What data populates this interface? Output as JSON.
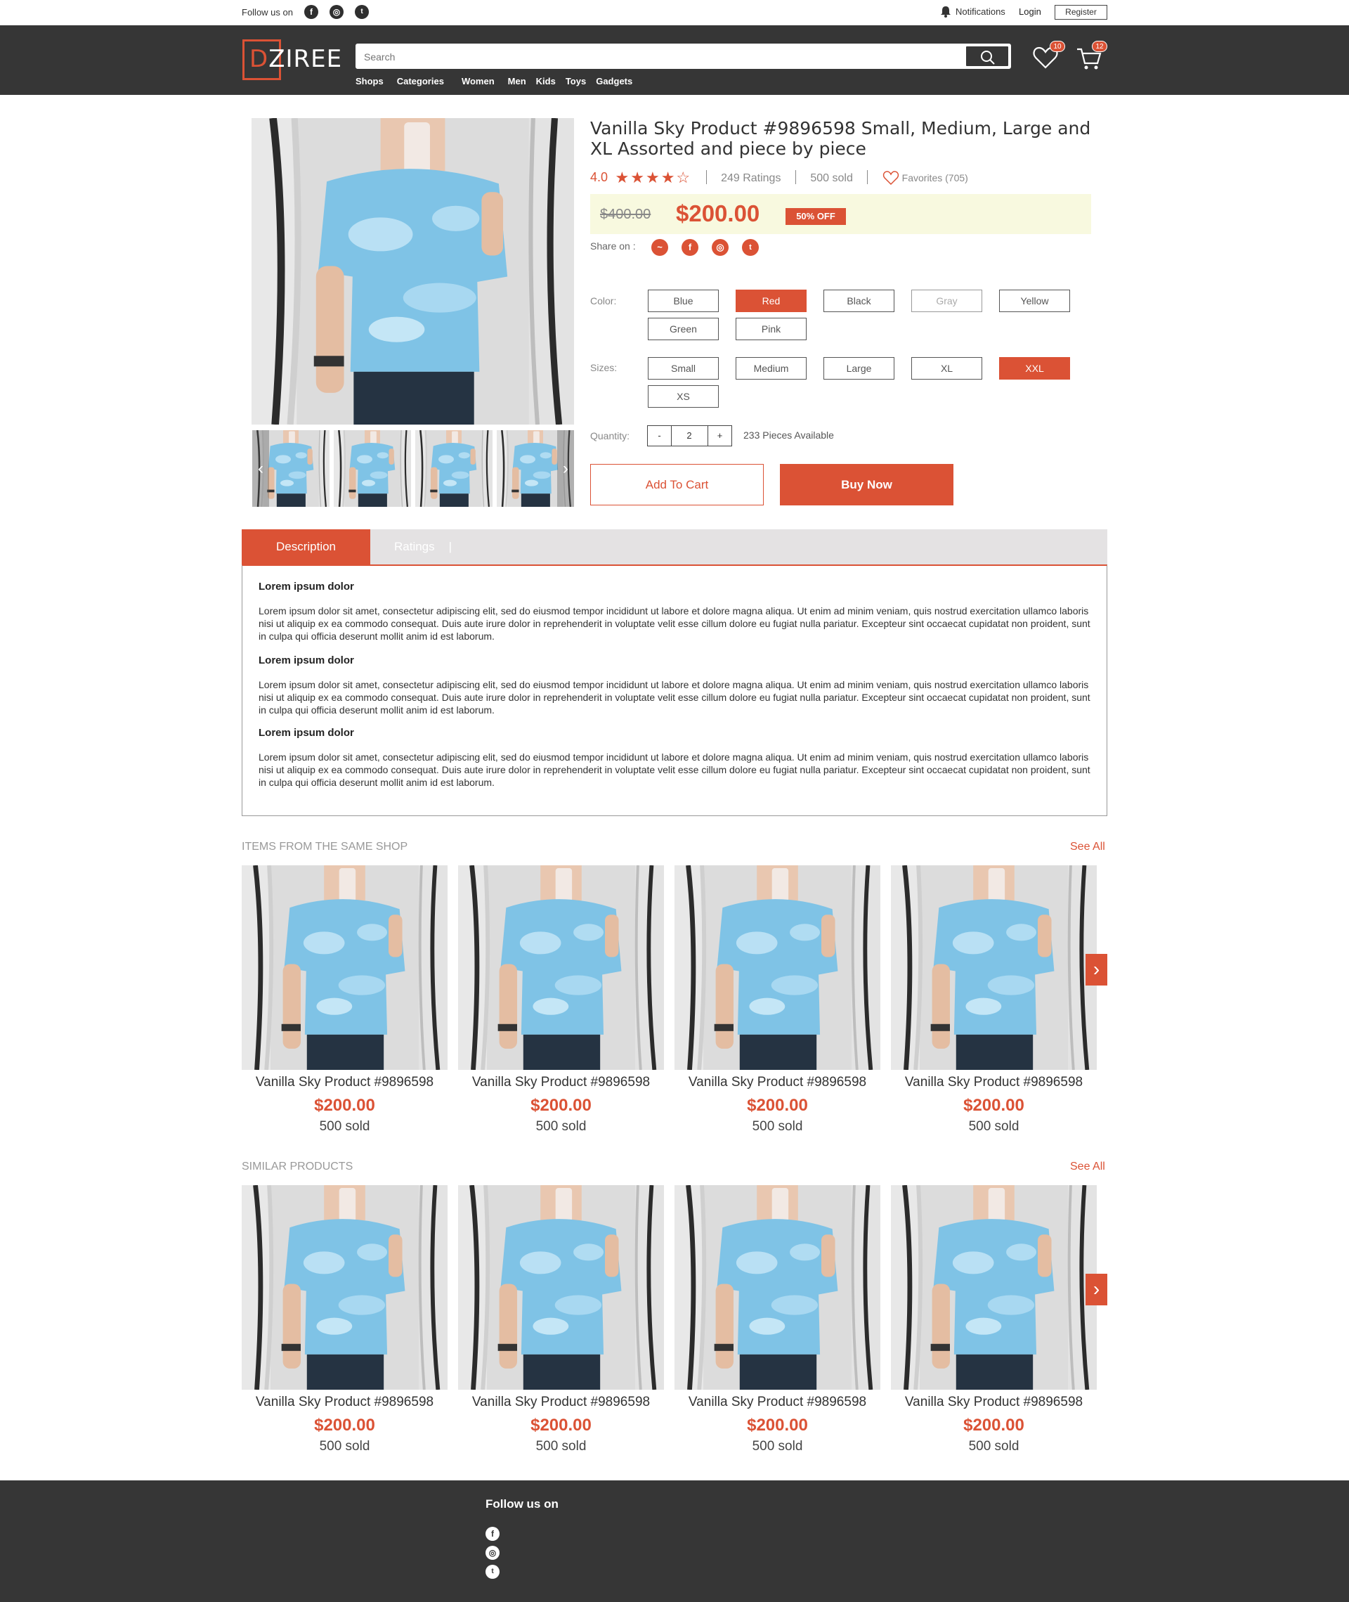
{
  "topbar": {
    "follow_label": "Follow us on",
    "social": [
      "facebook-icon",
      "instagram-icon",
      "twitter-icon"
    ],
    "notifications_label": "Notifications",
    "login_label": "Login",
    "register_label": "Register"
  },
  "header": {
    "logo_text_accent": "D",
    "logo_text": "ZIREE",
    "search_placeholder": "Search",
    "nav": [
      "Shops",
      "Categories",
      "Women",
      "Men",
      "Kids",
      "Toys",
      "Gadgets"
    ],
    "wishlist_count": "10",
    "cart_count": "12"
  },
  "product": {
    "title": "Vanilla Sky Product #9896598 Small, Medium, Large and XL Assorted and piece by piece",
    "rating_value": "4.0",
    "stars": 4,
    "ratings_label": "249 Ratings",
    "sold_label": "500 sold",
    "favorites_label": "Favorites (705)",
    "old_price": "$400.00",
    "price": "$200.00",
    "discount": "50% OFF",
    "share_label": "Share on :",
    "share_icons": [
      "messenger-icon",
      "facebook-icon",
      "instagram-icon",
      "twitter-icon"
    ],
    "color_label": "Color:",
    "colors": [
      "Blue",
      "Red",
      "Black",
      "Gray",
      "Yellow",
      "Green",
      "Pink"
    ],
    "selected_color": "Red",
    "disabled_color": "Gray",
    "sizes_label": "Sizes:",
    "sizes": [
      "Small",
      "Medium",
      "Large",
      "XL",
      "XXL",
      "XS"
    ],
    "selected_size": "XXL",
    "quantity_label": "Quantity:",
    "qty_minus": "-",
    "quantity": "2",
    "qty_plus": "+",
    "available": "233 Pieces Available",
    "add_to_cart": "Add To Cart",
    "buy_now": "Buy Now"
  },
  "tabs": {
    "description": "Description",
    "ratings": "Ratings",
    "ratings_sep": "|"
  },
  "description": [
    {
      "heading": "Lorem ipsum dolor",
      "text": "Lorem ipsum dolor sit amet, consectetur adipiscing elit, sed do eiusmod tempor incididunt ut labore et dolore magna aliqua. Ut enim ad minim veniam, quis nostrud exercitation ullamco laboris nisi ut aliquip ex ea commodo consequat. Duis aute irure dolor in reprehenderit in voluptate velit esse cillum dolore eu fugiat nulla pariatur. Excepteur sint occaecat cupidatat non proident, sunt in culpa qui officia deserunt mollit anim id est laborum."
    },
    {
      "heading": "Lorem ipsum dolor",
      "text": "Lorem ipsum dolor sit amet, consectetur adipiscing elit, sed do eiusmod tempor incididunt ut labore et dolore magna aliqua. Ut enim ad minim veniam, quis nostrud exercitation ullamco laboris nisi ut aliquip ex ea commodo consequat. Duis aute irure dolor in reprehenderit in voluptate velit esse cillum dolore eu fugiat nulla pariatur. Excepteur sint occaecat cupidatat non proident, sunt in culpa qui officia deserunt mollit anim id est laborum."
    },
    {
      "heading": "Lorem ipsum dolor",
      "text": "Lorem ipsum dolor sit amet, consectetur adipiscing elit, sed do eiusmod tempor incididunt ut labore et dolore magna aliqua. Ut enim ad minim veniam, quis nostrud exercitation ullamco laboris nisi ut aliquip ex ea commodo consequat. Duis aute irure dolor in reprehenderit in voluptate velit esse cillum dolore eu fugiat nulla pariatur. Excepteur sint occaecat cupidatat non proident, sunt in culpa qui officia deserunt mollit anim id est laborum."
    }
  ],
  "same_shop": {
    "title": "ITEMS FROM THE SAME SHOP",
    "see_all": "See All",
    "items": [
      {
        "name": "Vanilla Sky Product #9896598",
        "price": "$200.00",
        "sold": "500 sold"
      },
      {
        "name": "Vanilla Sky Product #9896598",
        "price": "$200.00",
        "sold": "500 sold"
      },
      {
        "name": "Vanilla Sky Product #9896598",
        "price": "$200.00",
        "sold": "500 sold"
      },
      {
        "name": "Vanilla Sky Product #9896598",
        "price": "$200.00",
        "sold": "500 sold"
      }
    ]
  },
  "similar": {
    "title": "SIMILAR PRODUCTS",
    "see_all": "See All",
    "items": [
      {
        "name": "Vanilla Sky Product #9896598",
        "price": "$200.00",
        "sold": "500 sold"
      },
      {
        "name": "Vanilla Sky Product #9896598",
        "price": "$200.00",
        "sold": "500 sold"
      },
      {
        "name": "Vanilla Sky Product #9896598",
        "price": "$200.00",
        "sold": "500 sold"
      },
      {
        "name": "Vanilla Sky Product #9896598",
        "price": "$200.00",
        "sold": "500 sold"
      }
    ]
  },
  "footer": {
    "follow_label": "Follow us on",
    "social": [
      "facebook-icon",
      "instagram-icon",
      "twitter-icon"
    ]
  },
  "colors": {
    "accent": "#db5235",
    "header_bg": "#363636",
    "price_box_bg": "#f8f9df"
  }
}
